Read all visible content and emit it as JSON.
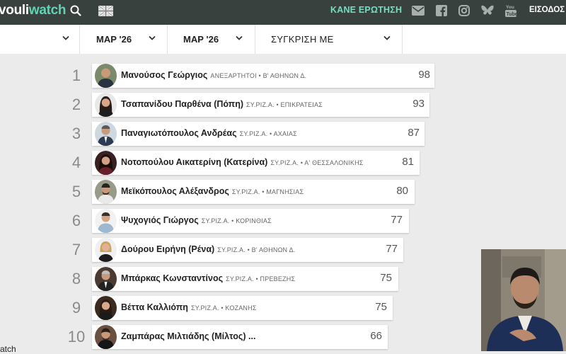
{
  "header": {
    "logo_part1": "vouli",
    "logo_part2": "watch",
    "ask_question": "ΚΑΝΕ ΕΡΩΤΗΣΗ",
    "login": "ΕΙΣΟΔΟΣ",
    "icons": [
      "search-icon",
      "flag-uk-icon",
      "mail-icon",
      "facebook-icon",
      "instagram-icon",
      "bluesky-icon",
      "youtube-icon"
    ]
  },
  "filters": {
    "from": "ΜΑΡ '26",
    "to": "ΜΑΡ '26",
    "compare": "ΣΥΓΚΡΙΣΗ ΜΕ"
  },
  "rows": [
    {
      "rank": "1",
      "name": "Μανούσος Γεώργιος",
      "party": "ΑΝΕΞΑΡΤΗΤΟΙ • Β' ΑΘΗΝΩΝ Δ.",
      "score": "98"
    },
    {
      "rank": "2",
      "name": "Τσαπανίδου Παρθένα (Πόπη)",
      "party": "ΣΥ.ΡΙΖ.Α. • ΕΠΙΚΡΑΤΕΙΑΣ",
      "score": "93"
    },
    {
      "rank": "3",
      "name": "Παναγιωτόπουλος Ανδρέας",
      "party": "ΣΥ.ΡΙΖ.Α. • ΑΧΑΙΑΣ",
      "score": "87"
    },
    {
      "rank": "4",
      "name": "Νοτοπούλου Αικατερίνη (Κατερίνα)",
      "party": "ΣΥ.ΡΙΖ.Α. • Α' ΘΕΣΣΑΛΟΝΙΚΗΣ",
      "score": "81"
    },
    {
      "rank": "5",
      "name": "Μεϊκόπουλος Αλέξανδρος",
      "party": "ΣΥ.ΡΙΖ.Α. • ΜΑΓΝΗΣΙΑΣ",
      "score": "80"
    },
    {
      "rank": "6",
      "name": "Ψυχογιός Γιώργος",
      "party": "ΣΥ.ΡΙΖ.Α. • ΚΟΡΙΝΘΙΑΣ",
      "score": "77"
    },
    {
      "rank": "7",
      "name": "Δούρου Ειρήνη (Ρένα)",
      "party": "ΣΥ.ΡΙΖ.Α. • Β' ΑΘΗΝΩΝ Δ.",
      "score": "77"
    },
    {
      "rank": "8",
      "name": "Μπάρκας Κωνσταντίνος",
      "party": "ΣΥ.ΡΙΖ.Α. • ΠΡΕΒΕΖΗΣ",
      "score": "75"
    },
    {
      "rank": "9",
      "name": "Βέττα Καλλιόπη",
      "party": "ΣΥ.ΡΙΖ.Α. • ΚΟΖΑΝΗΣ",
      "score": "75"
    },
    {
      "rank": "10",
      "name": "Ζαμπάρας Μιλτιάδης (Μίλτος) ...",
      "party": "",
      "score": "66"
    }
  ],
  "footer_watermark": "atch"
}
